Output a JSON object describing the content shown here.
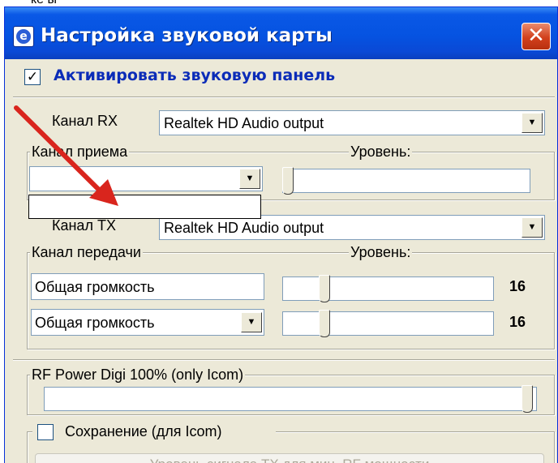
{
  "prev_fragment": "ке ы",
  "window": {
    "title": "Настройка звуковой карты",
    "close_glyph": "✕",
    "app_icon_glyph": "e"
  },
  "activate": {
    "label": "Активировать звуковую панель",
    "checked": true,
    "check_glyph": "✓"
  },
  "rx": {
    "label": "Канал RX",
    "device": "Realtek HD Audio output",
    "group_title": "Канал приема",
    "level_label": "Уровень:",
    "source": ""
  },
  "tx": {
    "label": "Канал TX",
    "device": "Realtek HD Audio output",
    "group_title": "Канал передачи",
    "level_label": "Уровень:",
    "rows": [
      {
        "source": "Общая громкость",
        "has_dropdown": false,
        "value": "16"
      },
      {
        "source": "Общая громкость",
        "has_dropdown": true,
        "value": "16"
      }
    ]
  },
  "rf": {
    "group_title": "RF Power Digi 100% (only Icom)"
  },
  "save": {
    "label": "Сохранение (для Icom)",
    "checked": false
  },
  "bottom_button": {
    "label": "Уровень сигнала TX для мин. RF мощности"
  },
  "dropdown_glyph": "▼",
  "colors": {
    "title_bar": "#0553e1",
    "window_face": "#ece9d8",
    "accent_label": "#0b2cb8",
    "close_button": "#d2401c",
    "annotation_arrow": "#d9251d"
  }
}
